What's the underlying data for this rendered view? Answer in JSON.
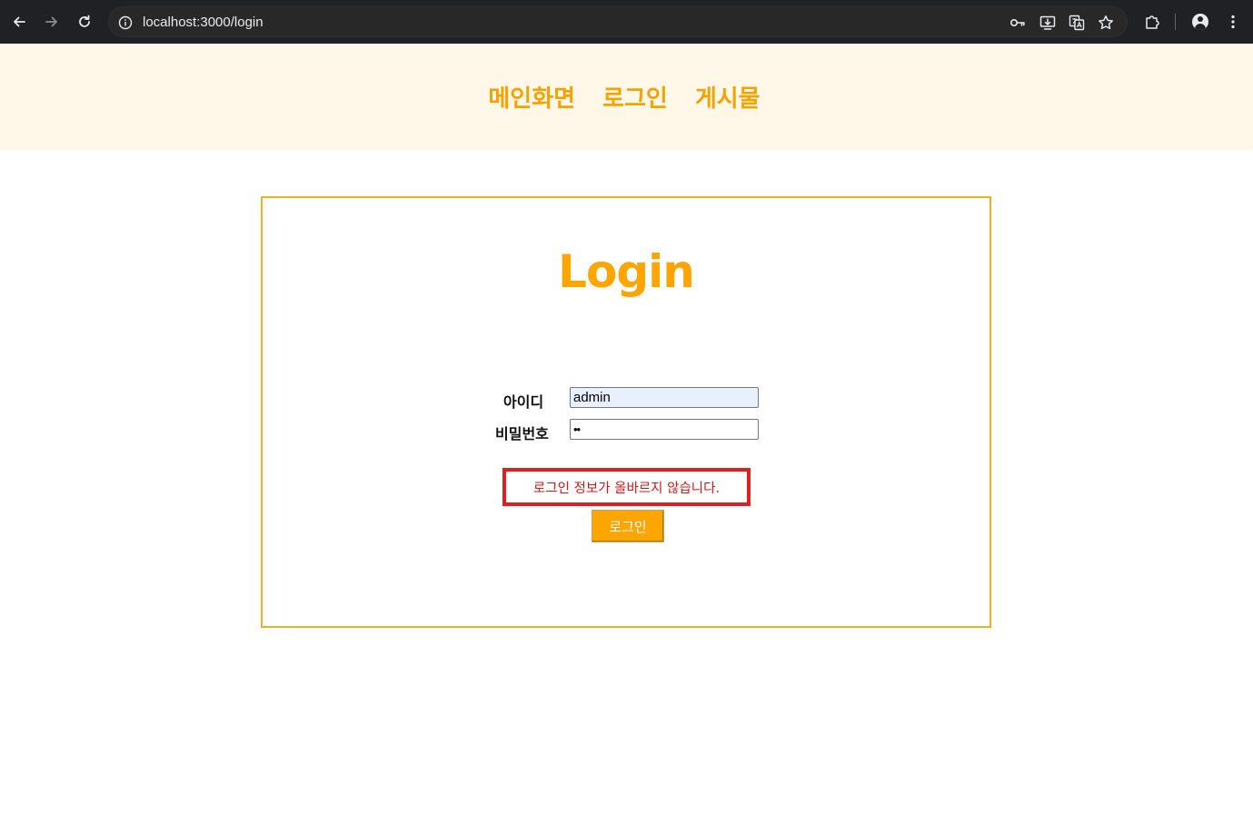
{
  "browser": {
    "url": "localhost:3000/login",
    "icons": {
      "back": "arrow-left",
      "forward": "arrow-right",
      "reload": "reload",
      "site_info": "info-circle",
      "password": "key",
      "install": "install-app",
      "translate": "translate",
      "bookmark": "star",
      "extensions": "puzzle-piece",
      "profile": "person-avatar",
      "menu": "three-dots-vertical"
    }
  },
  "nav": {
    "items": [
      {
        "label": "메인화면"
      },
      {
        "label": "로그인"
      },
      {
        "label": "게시물"
      }
    ],
    "color": "#f4a300",
    "background": "#fff8e8"
  },
  "login": {
    "title": "Login",
    "id_label": "아이디",
    "id_value": "admin",
    "password_label": "비밀번호",
    "password_value": "••",
    "error_message": "로그인 정보가 올바르지 않습니다.",
    "submit_label": "로그인",
    "accent_color": "#ffa500",
    "error_color": "#e02020"
  }
}
